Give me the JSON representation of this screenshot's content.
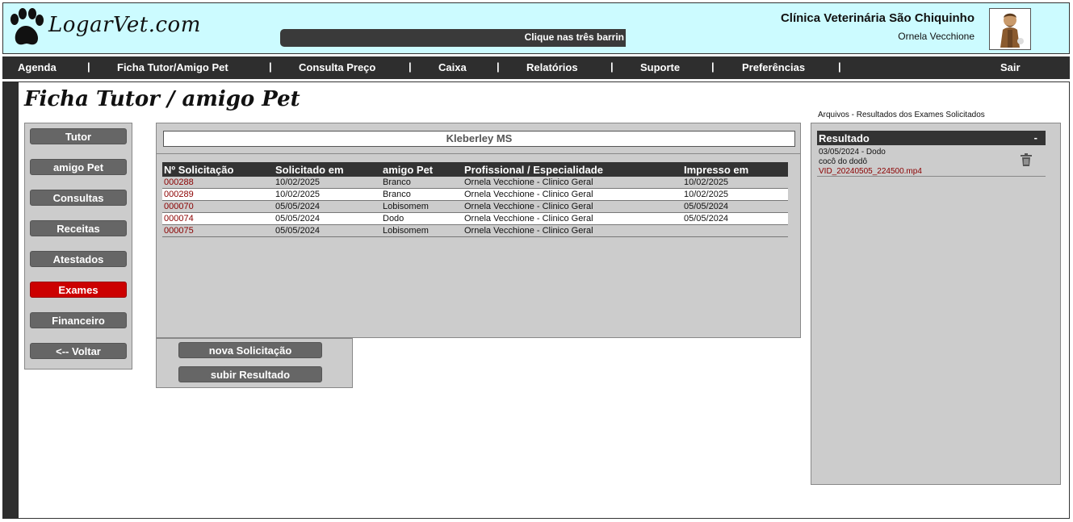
{
  "header": {
    "logo_text": "LogarVet.com",
    "ticker_text": "Clique nas três barrin",
    "clinic_name": "Clínica Veterinária São Chiquinho",
    "user_name": "Ornela Vecchione"
  },
  "nav": {
    "items": [
      "Agenda",
      "Ficha Tutor/Amigo Pet",
      "Consulta Preço",
      "Caixa",
      "Relatórios",
      "Suporte",
      "Preferências",
      "Sair"
    ],
    "separator": "|"
  },
  "page": {
    "title": "Ficha Tutor / amigo Pet"
  },
  "menu": {
    "items": [
      "Tutor",
      "amigo Pet",
      "Consultas",
      "Receitas",
      "Atestados",
      "Exames",
      "Financeiro",
      "<-- Voltar"
    ],
    "active": "Exames"
  },
  "tutor": {
    "name": "Kleberley MS"
  },
  "table": {
    "headers": [
      "Nº Solicitação",
      "Solicitado em",
      "amigo Pet",
      "Profissional / Especialidade",
      "Impresso em"
    ],
    "rows": [
      {
        "id": "000288",
        "date": "10/02/2025",
        "pet": "Branco",
        "prof": "Ornela Vecchione  -  Clinico Geral",
        "printed": "10/02/2025"
      },
      {
        "id": "000289",
        "date": "10/02/2025",
        "pet": "Branco",
        "prof": "Ornela Vecchione  -  Clinico Geral",
        "printed": "10/02/2025"
      },
      {
        "id": "000070",
        "date": "05/05/2024",
        "pet": "Lobisomem",
        "prof": "Ornela Vecchione  -  Clinico Geral",
        "printed": "05/05/2024"
      },
      {
        "id": "000074",
        "date": "05/05/2024",
        "pet": "Dodo",
        "prof": "Ornela Vecchione  -  Clinico Geral",
        "printed": "05/05/2024"
      },
      {
        "id": "000075",
        "date": "05/05/2024",
        "pet": "Lobisomem",
        "prof": "Ornela Vecchione  -  Clinico Geral",
        "printed": ""
      }
    ]
  },
  "actions": {
    "new_request": "nova Solicitação",
    "upload_result": "subir Resultado"
  },
  "files": {
    "label": "Arquivos - Resultados dos Exames Solicitados",
    "header": "Resultado",
    "collapse": "-",
    "entry": {
      "date_pet": "03/05/2024  -  Dodo",
      "description": "cocô do dodô",
      "filename": "VID_20240505_224500.mp4"
    }
  },
  "colors": {
    "header_bg": "#ccfbff",
    "nav_bg": "#2e2e2e",
    "active_btn": "#cc0000",
    "link": "#8b0000"
  },
  "icons": [
    "paw-icon",
    "avatar-image",
    "trash-icon"
  ]
}
